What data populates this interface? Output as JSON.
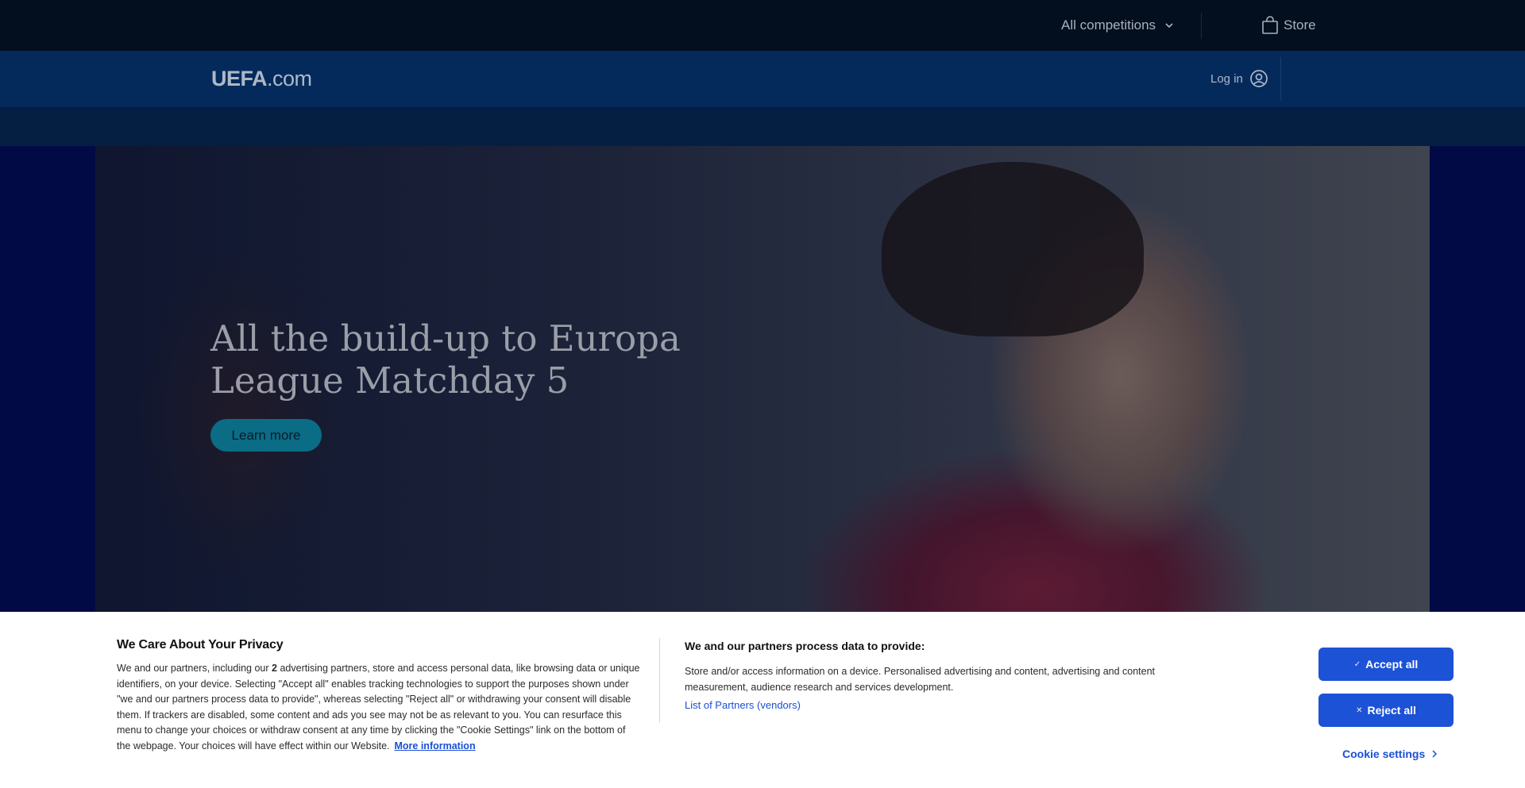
{
  "topbar": {
    "competitions_label": "All competitions",
    "store_label": "Store"
  },
  "nav": {
    "logo_main": "UEFA",
    "logo_suffix": ".com",
    "login_label": "Log in"
  },
  "hero": {
    "title": "All the build-up to Europa League Matchday 5",
    "cta_label": "Learn more"
  },
  "cookie": {
    "title": "We Care About Your Privacy",
    "body_pre": "We and our partners, including our ",
    "partner_count": "2",
    "body_post": " advertising partners, store and access personal data, like browsing data or unique identifiers, on your device. Selecting \"Accept all\" enables tracking technologies to support the purposes shown under \"we and our partners process data to provide\", whereas selecting \"Reject all\" or withdrawing your consent will disable them. If trackers are disabled, some content and ads you see may not be as relevant to you. You can resurface this menu to change your choices or withdraw consent at any time by clicking the \"Cookie Settings\" link on the bottom of the webpage. Your choices will have effect within our Website.",
    "more_info": "More information",
    "purposes_title": "We and our partners process data to provide:",
    "purposes_body": "Store and/or access information on a device. Personalised advertising and content, advertising and content measurement, audience research and services development.",
    "partners_link": "List of Partners (vendors)",
    "accept_label": "Accept all",
    "reject_label": "Reject all",
    "settings_label": "Cookie settings"
  },
  "colors": {
    "topbar_bg": "#030f1e",
    "nav_bg": "#042a5c",
    "hero_bg": "#020a45",
    "cta_bg": "#0b6c86",
    "button_blue": "#1c52d6"
  },
  "icons": [
    "chevron-down-icon",
    "shopping-bag-icon",
    "user-circle-icon",
    "check-icon",
    "close-icon",
    "chevron-right-icon"
  ]
}
